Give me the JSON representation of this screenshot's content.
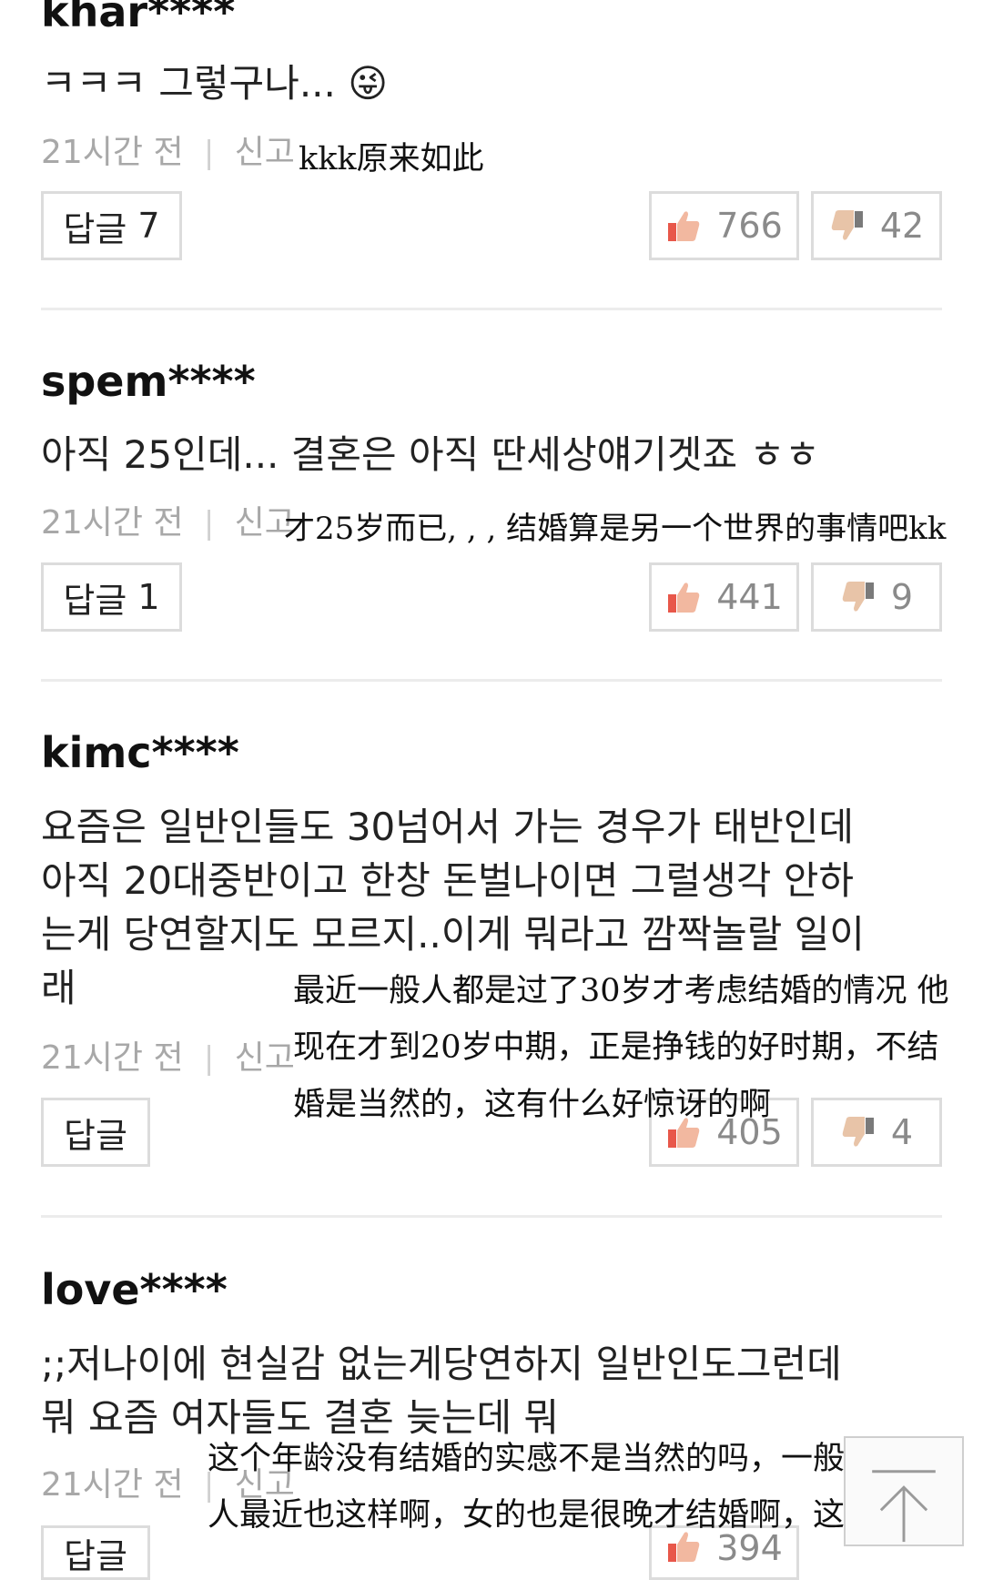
{
  "comments": [
    {
      "user": "khar****",
      "lines": [
        "ㅋㅋㅋ 그렇구나... 😜"
      ],
      "time": "21시간 전",
      "report": "신고",
      "translation": [
        "kkk原来如此"
      ],
      "reply_label": "답글",
      "reply_count": "7",
      "likes": "766",
      "dislikes": "42"
    },
    {
      "user": "spem****",
      "lines": [
        "아직 25인데... 결혼은 아직 딴세상얘기겟죠 ㅎㅎ"
      ],
      "time": "21시간 전",
      "report": "신고",
      "translation": [
        "才25岁而已, , , 结婚算是另一个世界的事情吧kk"
      ],
      "reply_label": "답글",
      "reply_count": "1",
      "likes": "441",
      "dislikes": "9"
    },
    {
      "user": "kimc****",
      "lines": [
        "요즘은 일반인들도 30넘어서 가는 경우가 태반인데",
        "아직 20대중반이고 한창 돈벌나이면 그럴생각 안하",
        "는게 당연할지도 모르지..이게 뭐라고 깜짝놀랄 일이",
        "래"
      ],
      "time": "21시간 전",
      "report": "신고",
      "translation": [
        "最近一般人都是过了30岁才考虑结婚的情况  他",
        "现在才到20岁中期，正是挣钱的好时期，不结",
        "婚是当然的，这有什么好惊讶的啊"
      ],
      "reply_label": "답글",
      "reply_count": "",
      "likes": "405",
      "dislikes": "4"
    },
    {
      "user": "love****",
      "lines": [
        ";;저나이에 현실감 없는게당연하지 일반인도그런데",
        "뭐 요즘 여자들도 결혼 늦는데 뭐"
      ],
      "time": "21시간 전",
      "report": "신고",
      "translation": [
        "这个年龄没有结婚的实感不是当然的吗，一般",
        "人最近也这样啊，女的也是很晚才结婚啊，这算什么"
      ],
      "reply_label": "답글",
      "reply_count": "",
      "likes": "394",
      "dislikes": ""
    }
  ],
  "colors": {
    "thumb_up": "#e8574a",
    "thumb_down": "#d9a88a",
    "border": "#dcdcdc"
  },
  "icons": {
    "like": "thumbs-up-icon",
    "dislike": "thumbs-down-icon",
    "scroll_top": "arrow-up-icon"
  }
}
